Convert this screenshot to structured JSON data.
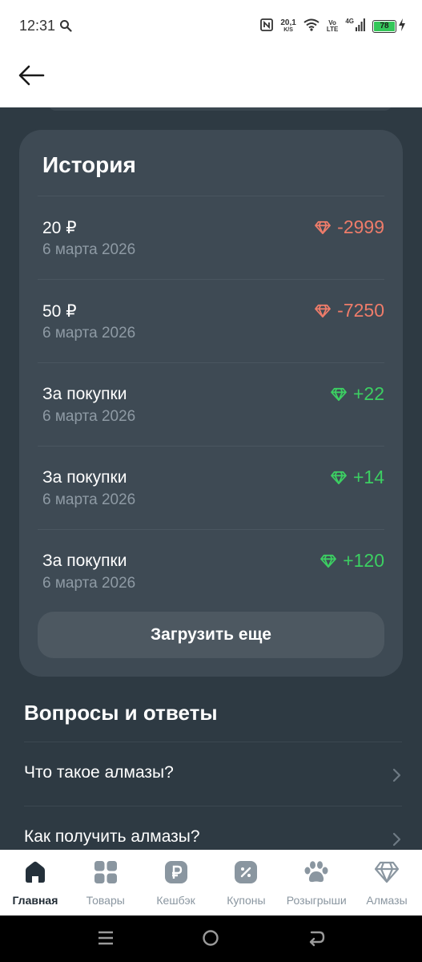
{
  "status_bar": {
    "time": "12:31",
    "net_speed_value": "20,1",
    "net_speed_unit": "K/S",
    "volte_top": "Vo",
    "volte_bottom": "LTE",
    "network": "4G",
    "battery_level": "78"
  },
  "history": {
    "title": "История",
    "items": [
      {
        "title": "20 ₽",
        "date": "6 марта 2026",
        "amount": "-2999",
        "type": "negative"
      },
      {
        "title": "50 ₽",
        "date": "6 марта 2026",
        "amount": "-7250",
        "type": "negative"
      },
      {
        "title": "За покупки",
        "date": "6 марта 2026",
        "amount": "+22",
        "type": "positive"
      },
      {
        "title": "За покупки",
        "date": "6 марта 2026",
        "amount": "+14",
        "type": "positive"
      },
      {
        "title": "За покупки",
        "date": "6 марта 2026",
        "amount": "+120",
        "type": "positive"
      }
    ],
    "load_more_label": "Загрузить еще"
  },
  "faq": {
    "title": "Вопросы и ответы",
    "items": [
      {
        "question": "Что такое алмазы?"
      },
      {
        "question": "Как получить алмазы?"
      }
    ]
  },
  "bottom_nav": {
    "items": [
      {
        "label": "Главная",
        "icon": "home-icon",
        "active": true
      },
      {
        "label": "Товары",
        "icon": "grid-icon",
        "active": false
      },
      {
        "label": "Кешбэк",
        "icon": "ruble-icon",
        "active": false
      },
      {
        "label": "Купоны",
        "icon": "coupon-icon",
        "active": false
      },
      {
        "label": "Розыгрыши",
        "icon": "paw-icon",
        "active": false
      },
      {
        "label": "Алмазы",
        "icon": "diamond-icon",
        "active": false
      }
    ]
  },
  "colors": {
    "background": "#2e3a43",
    "card": "#3e4a54",
    "negative": "#ee7c6a",
    "positive": "#3ccf62",
    "nav_inactive": "#8a96a0"
  }
}
